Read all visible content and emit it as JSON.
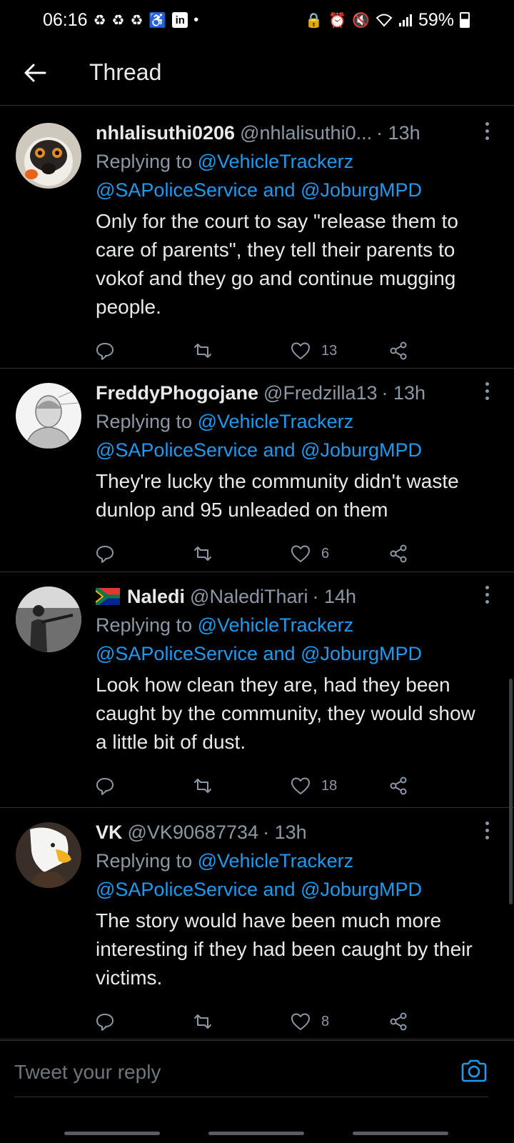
{
  "status_bar": {
    "time": "06:16",
    "battery": "59%",
    "linkedin_label": "in"
  },
  "header": {
    "title": "Thread"
  },
  "tweets": [
    {
      "display_name": "nhlalisuthi0206",
      "handle": "@nhlalisuthi0...",
      "time": "· 13h",
      "replying_prefix": "Replying to",
      "mention_1": "@VehicleTrackerz",
      "mention_2": "@SAPoliceService",
      "mention_joiner": " and ",
      "mention_3": "@JoburgMPD",
      "text": "Only for the court to say \"release them to care of parents\", they tell their parents to vokof and they go and continue mugging people.",
      "likes": "13",
      "avatar": "lemur"
    },
    {
      "display_name": "FreddyPhogojane",
      "handle": "@Fredzilla13",
      "time": "· 13h",
      "replying_prefix": "Replying to",
      "mention_1": "@VehicleTrackerz",
      "mention_2": "@SAPoliceService",
      "mention_joiner": " and ",
      "mention_3": "@JoburgMPD",
      "text": "They're lucky the community didn't waste dunlop and 95 unleaded on them",
      "likes": "6",
      "avatar": "man-sketch"
    },
    {
      "display_name": "Naledi",
      "handle": "@NalediThari",
      "time": "· 14h",
      "replying_prefix": "Replying to",
      "mention_1": "@VehicleTrackerz",
      "mention_2": "@SAPoliceService",
      "mention_joiner": " and ",
      "mention_3": "@JoburgMPD",
      "text": "Look how clean they are, had they been caught by the community, they would show a little bit of dust.",
      "likes": "18",
      "avatar": "person-rifle",
      "flag": "south-africa-flag"
    },
    {
      "display_name": "VK",
      "handle": "@VK90687734",
      "time": "· 13h",
      "replying_prefix": "Replying to",
      "mention_1": "@VehicleTrackerz",
      "mention_2": "@SAPoliceService",
      "mention_joiner": " and ",
      "mention_3": "@JoburgMPD",
      "text": "The story would have been much more interesting if they had been caught by their victims.",
      "likes": "8",
      "avatar": "eagle"
    }
  ],
  "reply_bar": {
    "placeholder": "Tweet your reply"
  },
  "colors": {
    "background": "#000000",
    "accent": "#1d9bf0",
    "secondary_text": "#8b98a5",
    "divider": "#2f3336"
  }
}
